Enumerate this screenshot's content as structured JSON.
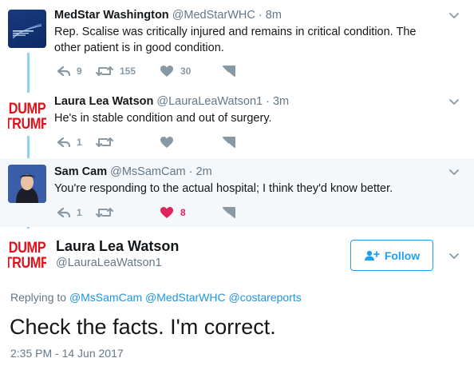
{
  "tweets": [
    {
      "name": "MedStar Washington",
      "handle": "@MedStarWHC",
      "dot": "·",
      "time": "8m",
      "text": "Rep. Scalise was critically injured and remains in critical condition. The other patient is in good condition.",
      "reply_count": "9",
      "retweet_count": "155",
      "like_count": "30"
    },
    {
      "name": "Laura Lea Watson",
      "handle": "@LauraLeaWatson1",
      "dot": "·",
      "time": "3m",
      "text": "He's in stable condition and out of surgery.",
      "reply_count": "1",
      "retweet_count": "",
      "like_count": ""
    },
    {
      "name": "Sam Cam",
      "handle": "@MsSamCam",
      "dot": "·",
      "time": "2m",
      "text": "You're responding to the actual hospital; I think they'd know better.",
      "reply_count": "1",
      "retweet_count": "",
      "like_count": "8"
    }
  ],
  "avatar_text": {
    "line1": "DUMP",
    "line2": "TRUMP"
  },
  "main": {
    "name": "Laura Lea Watson",
    "handle": "@LauraLeaWatson1",
    "follow_label": "Follow",
    "replying_prefix": "Replying to",
    "replying_to": [
      "@MsSamCam",
      "@MedStarWHC",
      "@costareports"
    ],
    "text": "Check the facts. I'm correct.",
    "timestamp": "2:35 PM - 14 Jun 2017"
  },
  "colors": {
    "accent": "#1da1f2",
    "link": "#1b95e0",
    "like_active": "#e0245e",
    "thread_line": "#8fd0f4",
    "muted": "#657786",
    "highlight_bg": "#f5f8fa"
  },
  "icons": {
    "reply": "reply-icon",
    "retweet": "retweet-icon",
    "like": "heart-icon",
    "dm": "direct-message-icon",
    "caret": "chevron-down-icon",
    "follow": "add-user-icon"
  }
}
